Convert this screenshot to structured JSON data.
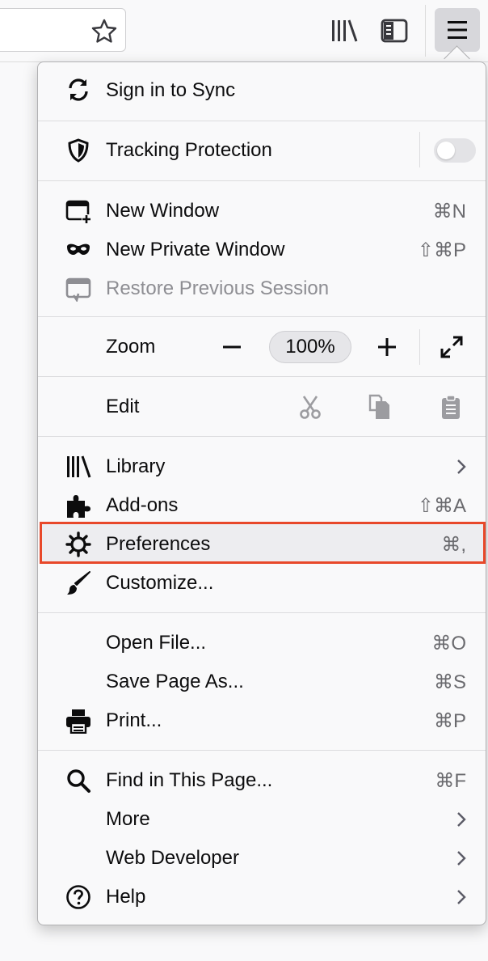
{
  "toolbar": {
    "icons": [
      "star-icon",
      "library-icon",
      "sidebar-icon",
      "hamburger-menu-icon"
    ]
  },
  "menu": {
    "sync": {
      "label": "Sign in to Sync"
    },
    "tracking": {
      "label": "Tracking Protection",
      "enabled": false
    },
    "new_window": {
      "label": "New Window",
      "shortcut": "⌘N"
    },
    "new_private_window": {
      "label": "New Private Window",
      "shortcut": "⇧⌘P"
    },
    "restore_session": {
      "label": "Restore Previous Session",
      "disabled": true
    },
    "zoom": {
      "label": "Zoom",
      "level": "100%",
      "minus": "−",
      "plus": "+"
    },
    "edit": {
      "label": "Edit"
    },
    "library": {
      "label": "Library"
    },
    "addons": {
      "label": "Add-ons",
      "shortcut": "⇧⌘A"
    },
    "preferences": {
      "label": "Preferences",
      "shortcut": "⌘,",
      "highlight_color": "#e8482a"
    },
    "customize": {
      "label": "Customize..."
    },
    "open_file": {
      "label": "Open File...",
      "shortcut": "⌘O"
    },
    "save_page": {
      "label": "Save Page As...",
      "shortcut": "⌘S"
    },
    "print": {
      "label": "Print...",
      "shortcut": "⌘P"
    },
    "find": {
      "label": "Find in This Page...",
      "shortcut": "⌘F"
    },
    "more": {
      "label": "More"
    },
    "web_developer": {
      "label": "Web Developer"
    },
    "help": {
      "label": "Help"
    }
  }
}
